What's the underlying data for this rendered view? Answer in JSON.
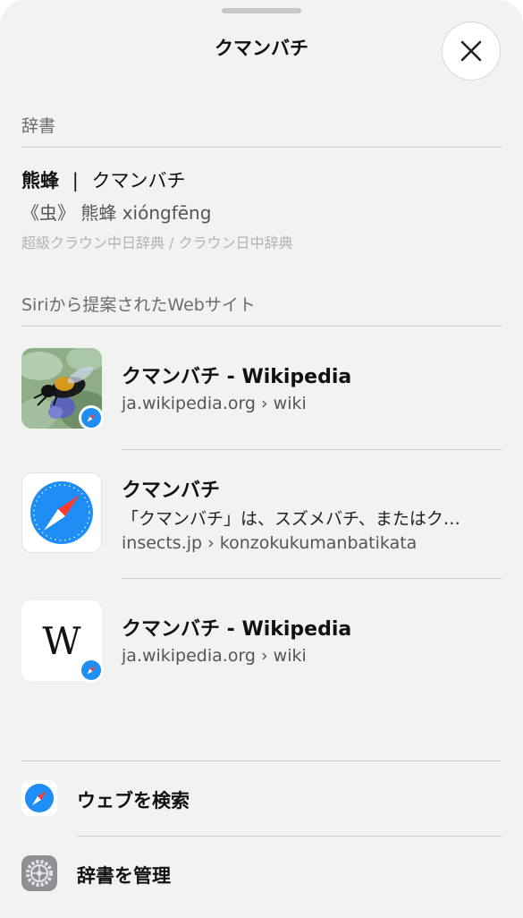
{
  "header": {
    "title": "クマンバチ",
    "close_icon": "xmark-icon"
  },
  "dictionary": {
    "section_title": "辞書",
    "headword": "熊蜂",
    "separator": "|",
    "reading": "クマンバチ",
    "definition": "《虫》 熊蜂 xióngfēng",
    "source": "超級クラウン中日辞典 / クラウン日中辞典"
  },
  "web": {
    "section_title": "Siriから提案されたWebサイト",
    "results": [
      {
        "title": "クマンバチ - Wikipedia",
        "url": "ja.wikipedia.org › wiki",
        "thumb": "bee-photo",
        "badge": "safari-icon"
      },
      {
        "title": "クマンバチ",
        "snippet": "「クマンバチ」は、スズメバチ、またはク…",
        "url": "insects.jp › konzokukumanbatikata",
        "thumb": "safari-icon"
      },
      {
        "title": "クマンバチ - Wikipedia",
        "url": "ja.wikipedia.org › wiki",
        "thumb": "wikipedia-logo",
        "thumb_text": "W",
        "badge": "safari-icon"
      }
    ]
  },
  "actions": [
    {
      "label": "ウェブを検索",
      "icon": "safari-icon"
    },
    {
      "label": "辞書を管理",
      "icon": "settings-gear-icon"
    }
  ],
  "colors": {
    "safari_blue": "#1e8ef5",
    "safari_red": "#ff3b30",
    "sheet_bg": "#f2f2f0"
  }
}
